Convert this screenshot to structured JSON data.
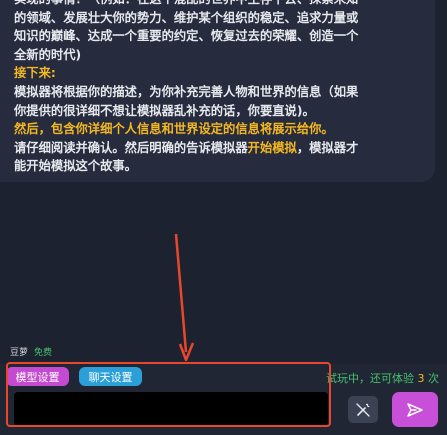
{
  "card": {
    "cut_line": "实现的事情？（例如：在这个混乱的世界中生存下去、探索未知",
    "line_a": "的领域、发展壮大你的势力、维护某个组织的稳定、追求力量或",
    "line_b": "知识的巅峰、达成一个重要的约定、恢复过去的荣耀、创造一个",
    "line_c": "全新的时代)",
    "next_heading": "接下来:",
    "line_d": "模拟器将根据你的描述，为你补充完善人物和世界的信息（如果",
    "line_e": "你提供的很详细不想让模拟器乱补充的话，你要直说)。",
    "then_line": "然后，包含你详细个人信息和世界设定的信息将展示给你。",
    "line_f_pre": "请仔细阅读并确认。然后明确的告诉模拟器",
    "line_f_hl": "开始模拟",
    "line_f_post": "，模拟器才",
    "line_g": "能开始模拟这个故事。"
  },
  "model": {
    "name": "豆萝",
    "badge": "免费"
  },
  "buttons": {
    "model_settings": "模型设置",
    "chat_settings": "聊天设置"
  },
  "trial": {
    "text": "试玩中，还可体验",
    "count": "3",
    "unit": " 次"
  },
  "input": {
    "value": "",
    "placeholder": ""
  },
  "icons": {
    "tool": "wand-slash-icon",
    "send": "send-icon"
  },
  "colors": {
    "accent_purple": "#c84fd8",
    "accent_blue": "#2a9fd8",
    "highlight_yellow": "#f5b820",
    "free_green": "#45c16b",
    "annotation_red": "#e8472c"
  }
}
